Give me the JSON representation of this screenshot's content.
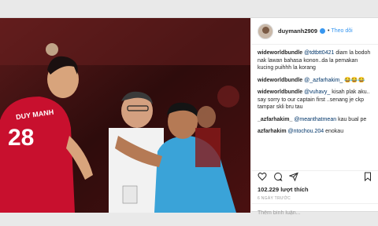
{
  "post": {
    "username": "duymanh2909",
    "verified": true,
    "separator": "•",
    "follow_label": "Theo dõi",
    "player_name": "DUY MANH",
    "player_number": "28"
  },
  "comments": [
    {
      "user": "wideworldbundle",
      "mention": "@tdtbtt0421",
      "text": " diam la bodoh nak lawan bahasa konon..da la pemakan kucing puihhh la korang"
    },
    {
      "user": "wideworldbundle",
      "mention": "@_azfarhakim_",
      "text": " 😂😂😂"
    },
    {
      "user": "wideworldbundle",
      "mention": "@vuhavy_",
      "text": " kisah plak aku.. say sorry to our captain first ..senang je ckp tampar skli bru tau"
    },
    {
      "user": "_azfarhakim_",
      "mention": "@meanthatmean",
      "text": " kau bual pe"
    },
    {
      "user": "azfarhakim",
      "mention": "@ntochou.204",
      "text": " enokau"
    }
  ],
  "likes_text": "102.229 lượt thích",
  "time_text": "6 NGÀY TRƯỚC",
  "add_comment_placeholder": "Thêm bình luận...",
  "icons": [
    "heart-icon",
    "comment-icon",
    "share-icon",
    "bookmark-icon"
  ],
  "colors": {
    "link": "#3897f0",
    "jersey": "#c8102e",
    "coach_shirt": "#3aa3d8"
  }
}
